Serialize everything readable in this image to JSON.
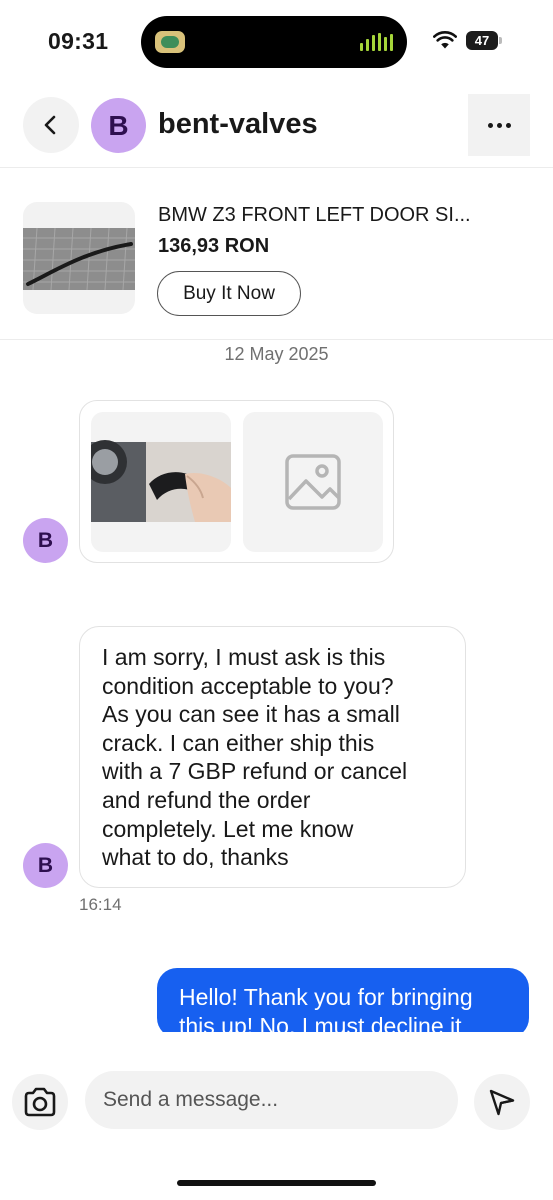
{
  "status_bar": {
    "time": "09:31",
    "battery": "47",
    "icons": [
      "app-activity-icon",
      "audio-level-icon",
      "wifi-icon",
      "battery-icon"
    ]
  },
  "header": {
    "avatar_initial": "B",
    "title": "bent-valves",
    "icons": [
      "back-arrow-icon",
      "more-dots-icon"
    ]
  },
  "item": {
    "title": "BMW Z3 FRONT LEFT DOOR SI...",
    "price": "136,93 RON",
    "buy_label": "Buy It Now"
  },
  "conversation": {
    "date": "12 May 2025",
    "attachments": [
      {
        "kind": "photo"
      },
      {
        "kind": "image-placeholder-icon"
      }
    ],
    "messages": [
      {
        "from": "bent-valves",
        "avatar_initial": "B",
        "text": "I am sorry, I must ask is this\ncondition acceptable to you?\nAs you can see it has a small\ncrack. I can either ship this\nwith a 7 GBP refund or  cancel\nand refund the order\ncompletely. Let me know\nwhat to do, thanks",
        "time": "16:14"
      },
      {
        "from": "me",
        "text": "Hello! Thank you for bringing\nthis up! No, I must decline it"
      }
    ]
  },
  "composer": {
    "placeholder": "Send a message...",
    "icons": [
      "camera-icon",
      "send-icon"
    ]
  },
  "colors": {
    "accent_blue": "#1760f0",
    "avatar_purple": "#c9a4f0",
    "avatar_text": "#2e0f4f",
    "surface_gray": "#f2f2f2"
  }
}
